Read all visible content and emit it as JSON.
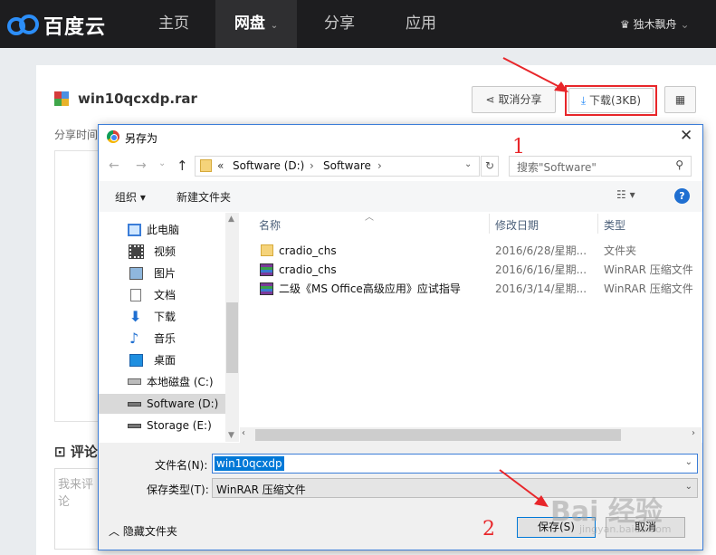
{
  "header": {
    "logo_text": "百度云",
    "nav": [
      "主页",
      "网盘",
      "分享",
      "应用"
    ],
    "active_nav": "网盘",
    "user_name": "独木飘舟"
  },
  "file": {
    "name": "win10qcxdp.rar",
    "share_time_label": "分享时间",
    "cancel_share_label": "取消分享",
    "download_label": "下载(3KB)",
    "comment_label": "评论",
    "comment_placeholder": "我来评论"
  },
  "dialog": {
    "title": "另存为",
    "breadcrumb": [
      "«",
      "Software (D:)",
      "›",
      "Software",
      "›"
    ],
    "search_placeholder": "搜索\"Software\"",
    "toolbar": {
      "organize": "组织 ▾",
      "new_folder": "新建文件夹"
    },
    "sidebar": [
      {
        "label": "此电脑",
        "icon": "computer-icon"
      },
      {
        "label": "视频",
        "icon": "video-icon"
      },
      {
        "label": "图片",
        "icon": "picture-icon"
      },
      {
        "label": "文档",
        "icon": "document-icon"
      },
      {
        "label": "下载",
        "icon": "download-icon"
      },
      {
        "label": "音乐",
        "icon": "music-icon"
      },
      {
        "label": "桌面",
        "icon": "desktop-icon"
      },
      {
        "label": "本地磁盘 (C:)",
        "icon": "drive-icon"
      },
      {
        "label": "Software (D:)",
        "icon": "drive-icon",
        "selected": true
      },
      {
        "label": "Storage (E:)",
        "icon": "drive-icon"
      }
    ],
    "columns": [
      "名称",
      "修改日期",
      "类型"
    ],
    "files": [
      {
        "name": "cradio_chs",
        "date": "2016/6/28/星期...",
        "type": "文件夹",
        "icon": "folder-icon"
      },
      {
        "name": "cradio_chs",
        "date": "2016/6/16/星期...",
        "type": "WinRAR 压缩文件",
        "icon": "rar-icon"
      },
      {
        "name": "二级《MS Office高级应用》应试指导",
        "date": "2016/3/14/星期...",
        "type": "WinRAR 压缩文件",
        "icon": "rar-icon"
      }
    ],
    "filename_label": "文件名(N):",
    "filename_value": "win10qcxdp",
    "filetype_label": "保存类型(T):",
    "filetype_value": "WinRAR 压缩文件",
    "hide_folders": "隐藏文件夹",
    "save_label": "保存(S)",
    "cancel_label": "取消"
  },
  "annotations": {
    "step1": "1",
    "step2": "2",
    "color": "#e8262a"
  },
  "watermark": {
    "text": "Bai 经验",
    "sub": "jingyan.baidu.com"
  }
}
